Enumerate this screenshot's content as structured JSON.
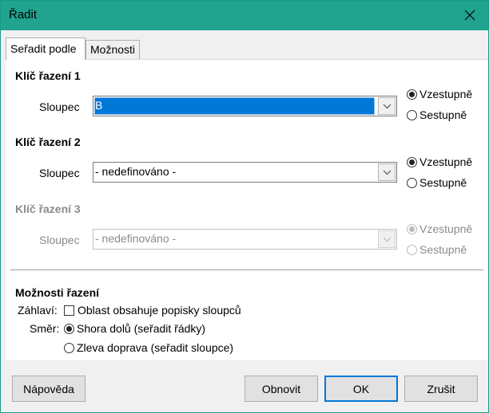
{
  "window": {
    "title": "Řadit"
  },
  "tabs": [
    {
      "label": "Seřadit podle",
      "active": true
    },
    {
      "label": "Možnosti",
      "active": false
    }
  ],
  "keys": [
    {
      "title": "Klíč řazení 1",
      "column_label": "Sloupec",
      "value": "B",
      "ascending": "Vzestupně",
      "descending": "Sestupně",
      "selected": "ascending",
      "enabled": true
    },
    {
      "title": "Klíč řazení 2",
      "column_label": "Sloupec",
      "value": "- nedefinováno -",
      "ascending": "Vzestupně",
      "descending": "Sestupně",
      "selected": "ascending",
      "enabled": true
    },
    {
      "title": "Klíč řazení 3",
      "column_label": "Sloupec",
      "value": "- nedefinováno -",
      "ascending": "Vzestupně",
      "descending": "Sestupně",
      "selected": "ascending",
      "enabled": false
    }
  ],
  "options": {
    "title": "Možnosti řazení",
    "header_label": "Záhlaví:",
    "header_checkbox": "Oblast obsahuje popisky sloupců",
    "header_checked": false,
    "direction_label": "Směr:",
    "direction_top_bottom": "Shora dolů (seřadit řádky)",
    "direction_left_right": "Zleva doprava (seřadit sloupce)",
    "direction_selected": "top_bottom"
  },
  "footer": {
    "help": "Nápověda",
    "reset": "Obnovit",
    "ok": "OK",
    "cancel": "Zrušit"
  },
  "colors": {
    "titlebar": "#20a38f",
    "selection": "#0078d7"
  }
}
